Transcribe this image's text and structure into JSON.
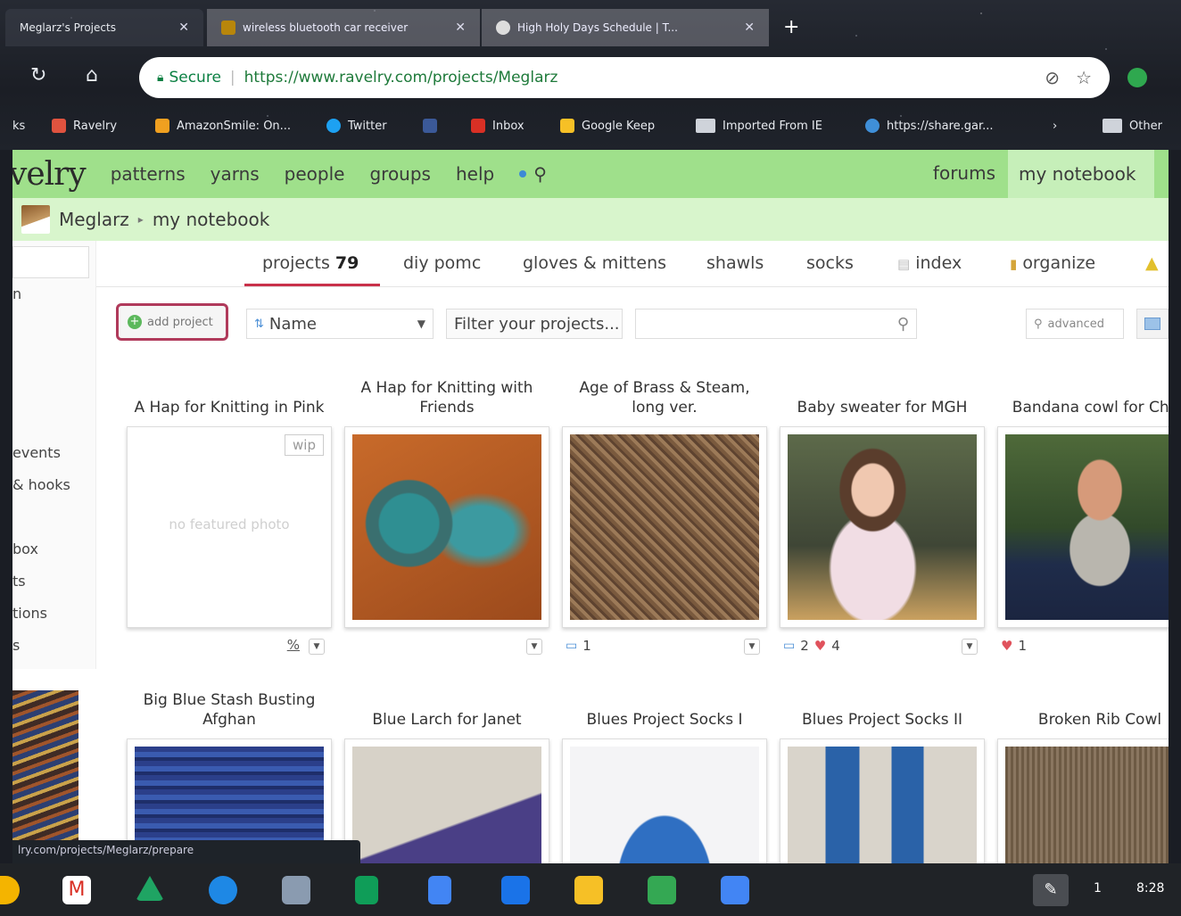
{
  "browser": {
    "tabs": [
      {
        "title": "Meglarz's Projects",
        "active": true
      },
      {
        "title": "wireless bluetooth car receiver",
        "active": false
      },
      {
        "title": "High Holy Days Schedule | T...",
        "active": false
      }
    ],
    "address": {
      "secure_label": "Secure",
      "url": "https://www.ravelry.com/projects/Meglarz"
    },
    "bookmarks": [
      "ks",
      "Ravelry",
      "AmazonSmile: On...",
      "Twitter",
      "",
      "Inbox",
      "Google Keep",
      "Imported From IE",
      "https://share.gar...",
      "Other"
    ]
  },
  "site": {
    "logo": "velry",
    "nav": [
      "patterns",
      "yarns",
      "people",
      "groups",
      "help"
    ],
    "nav_right": [
      "forums",
      "my notebook"
    ],
    "breadcrumb": [
      "Meglarz",
      "my notebook"
    ]
  },
  "sidebar": {
    "items": [
      "n",
      "events",
      "& hooks",
      "box",
      "ts",
      "tions",
      "s"
    ]
  },
  "notebook_tabs": {
    "projects_label": "projects",
    "projects_count": "79",
    "others": [
      "diy pomc",
      "gloves & mittens",
      "shawls",
      "socks",
      "index",
      "organize"
    ]
  },
  "controls": {
    "add_project": "add project",
    "sort_value": "Name",
    "filter_value": "Filter your projects...",
    "search_placeholder": "",
    "advanced": "advanced"
  },
  "projects": [
    {
      "title": "A Hap for Knitting in Pink",
      "badge": "wip",
      "no_photo": "no featured photo",
      "pct": "%",
      "comments": "",
      "hearts": ""
    },
    {
      "title": "A Hap for Knitting with Friends",
      "comments": "",
      "hearts": ""
    },
    {
      "title": "Age of Brass & Steam, long ver.",
      "comments": "1",
      "hearts": ""
    },
    {
      "title": "Baby sweater for MGH",
      "comments": "2",
      "hearts": "4"
    },
    {
      "title": "Bandana cowl for Chris",
      "comments": "",
      "hearts": "1"
    },
    {
      "title": "Big Blue Stash Busting Afghan"
    },
    {
      "title": "Blue Larch for Janet"
    },
    {
      "title": "Blues Project Socks I"
    },
    {
      "title": "Blues Project Socks II"
    },
    {
      "title": "Broken Rib Cowl"
    }
  ],
  "status_url": "lry.com/projects/Meglarz/prepare",
  "shelf": {
    "badge": "1",
    "time": "8:28"
  },
  "colors": {
    "navbar": "#9fe08b",
    "crumbbar": "#d8f5cc",
    "accent": "#c9314a"
  }
}
